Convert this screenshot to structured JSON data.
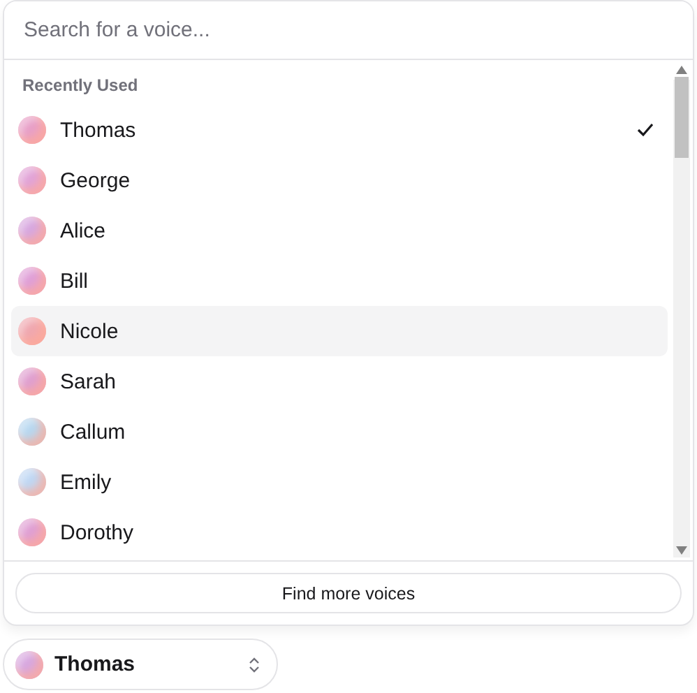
{
  "search": {
    "placeholder": "Search for a voice..."
  },
  "group_label": "Recently Used",
  "voices": [
    {
      "name": "Thomas",
      "selected": true,
      "highlighted": false,
      "color": "#e8a0c8"
    },
    {
      "name": "George",
      "selected": false,
      "highlighted": false,
      "color": "#e2a4d8"
    },
    {
      "name": "Alice",
      "selected": false,
      "highlighted": false,
      "color": "#d8a8e0"
    },
    {
      "name": "Bill",
      "selected": false,
      "highlighted": false,
      "color": "#e0a0d8"
    },
    {
      "name": "Nicole",
      "selected": false,
      "highlighted": true,
      "color": "#f0a8b0"
    },
    {
      "name": "Sarah",
      "selected": false,
      "highlighted": false,
      "color": "#e0a0d0"
    },
    {
      "name": "Callum",
      "selected": false,
      "highlighted": false,
      "color": "#b8d8f0"
    },
    {
      "name": "Emily",
      "selected": false,
      "highlighted": false,
      "color": "#c0d8f4"
    },
    {
      "name": "Dorothy",
      "selected": false,
      "highlighted": false,
      "color": "#e0a0d4"
    }
  ],
  "footer_button": "Find more voices",
  "trigger": {
    "label": "Thomas",
    "color": "#d8a8e0"
  }
}
